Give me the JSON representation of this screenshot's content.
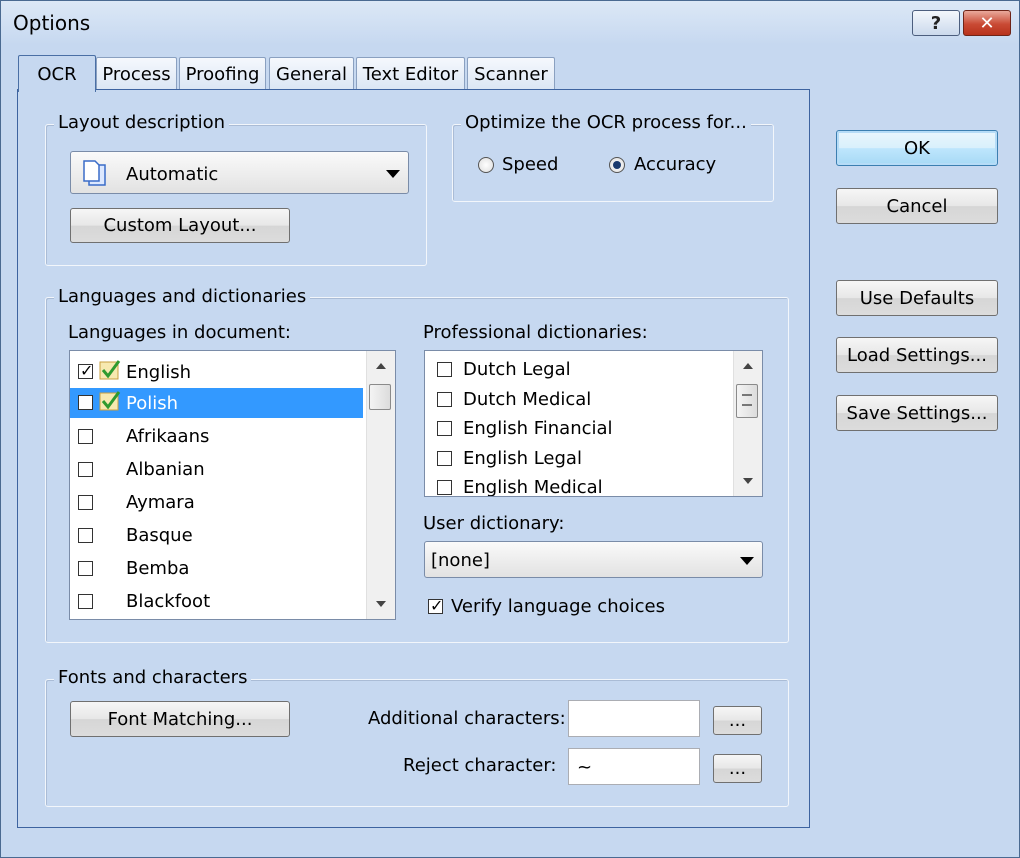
{
  "window": {
    "title": "Options",
    "help_label": "?",
    "close_label": "✕"
  },
  "tabs": [
    {
      "label": "OCR",
      "active": true
    },
    {
      "label": "Process"
    },
    {
      "label": "Proofing"
    },
    {
      "label": "General"
    },
    {
      "label": "Text Editor"
    },
    {
      "label": "Scanner"
    }
  ],
  "layout": {
    "legend": "Layout description",
    "combo_value": "Automatic",
    "custom_button": "Custom Layout..."
  },
  "optimize": {
    "legend": "Optimize the OCR process for...",
    "speed_label": "Speed",
    "accuracy_label": "Accuracy",
    "selected": "Accuracy"
  },
  "languages": {
    "legend": "Languages and dictionaries",
    "doc_label": "Languages in document:",
    "items": [
      {
        "name": "English",
        "checked": true,
        "dict": true
      },
      {
        "name": "Polish",
        "checked": false,
        "dict": true,
        "selected": true
      },
      {
        "name": "Afrikaans",
        "checked": false
      },
      {
        "name": "Albanian",
        "checked": false
      },
      {
        "name": "Aymara",
        "checked": false
      },
      {
        "name": "Basque",
        "checked": false
      },
      {
        "name": "Bemba",
        "checked": false
      },
      {
        "name": "Blackfoot",
        "checked": false
      }
    ],
    "prof_label": "Professional dictionaries:",
    "prof_items": [
      "Dutch Legal",
      "Dutch Medical",
      "English Financial",
      "English Legal",
      "English Medical"
    ],
    "user_dict_label": "User dictionary:",
    "user_dict_value": "[none]",
    "verify_label": "Verify language choices",
    "verify_checked": true
  },
  "fonts": {
    "legend": "Fonts and characters",
    "font_matching": "Font Matching...",
    "additional_label": "Additional characters:",
    "additional_value": "",
    "reject_label": "Reject character:",
    "reject_value": "~",
    "ellipsis": "..."
  },
  "buttons": {
    "ok": "OK",
    "cancel": "Cancel",
    "defaults": "Use Defaults",
    "load": "Load Settings...",
    "save": "Save Settings..."
  },
  "colors": {
    "selection": "#3399ff",
    "dialog_bg": "#c6d8f0"
  }
}
